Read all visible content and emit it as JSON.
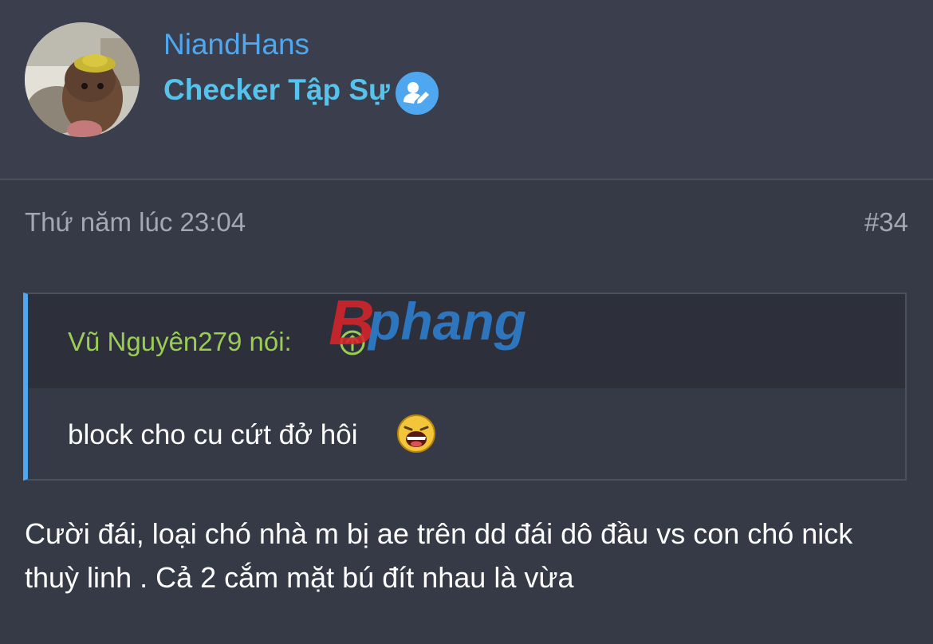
{
  "user": {
    "name": "NiandHans",
    "role": "Checker Tập Sự",
    "role_icon": "user-edit-icon",
    "avatar": "avatar-dog-photo"
  },
  "post": {
    "timestamp": "Thứ năm lúc 23:04",
    "number": "#34",
    "quote": {
      "author": "Vũ Nguyên279 nói:",
      "arrow_icon": "arrow-up-circle-icon",
      "text": "block cho cu cứt đở hôi",
      "emoji": "laughing-emoji"
    },
    "body": "Cười đái, loại chó nhà m bị ae trên dd đái dô đầu vs con chó nick thuỳ linh . Cả 2 cắm mặt bú đít nhau là vừa"
  },
  "watermark": {
    "text": "phang",
    "initial": "B"
  },
  "colors": {
    "background": "#363a47",
    "link_blue": "#4fa7ef",
    "role_cyan": "#56c3ec",
    "quote_author_green": "#9acd54",
    "muted_text": "#a4a8b2"
  }
}
